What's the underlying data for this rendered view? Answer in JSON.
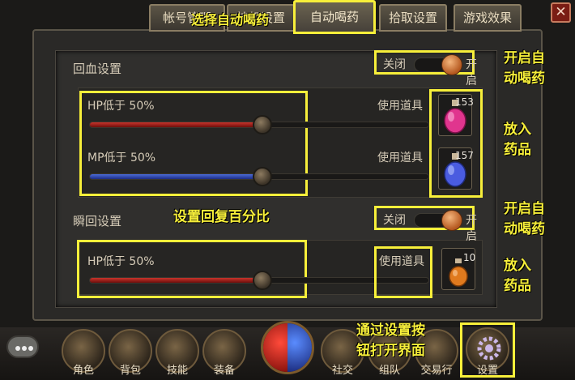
{
  "tabs": [
    {
      "label": "帐号管理"
    },
    {
      "label": "挂机设置"
    },
    {
      "label": "自动喝药"
    },
    {
      "label": "拾取设置"
    },
    {
      "label": "游戏效果"
    }
  ],
  "close_label": "✕",
  "section_hp": {
    "title": "回血设置",
    "toggle": {
      "off_label": "关闭",
      "on_label": "开启",
      "state": "on"
    },
    "rows": [
      {
        "label": "HP低于 50%",
        "value_percent": 50,
        "item_label": "使用道具",
        "count": "153",
        "potion_color": "#e0358e"
      },
      {
        "label": "MP低于 50%",
        "value_percent": 50,
        "item_label": "使用道具",
        "count": "157",
        "potion_color": "#4a5ce0"
      }
    ]
  },
  "section_instant": {
    "title": "瞬回设置",
    "toggle": {
      "off_label": "关闭",
      "on_label": "开启",
      "state": "on"
    },
    "rows": [
      {
        "label": "HP低于 50%",
        "value_percent": 50,
        "item_label": "使用道具",
        "count": "10",
        "potion_color": "#e07a1e"
      }
    ]
  },
  "annotations": {
    "select_tab": "选择自动喝药",
    "enable_1": [
      "开启自",
      "动喝药"
    ],
    "place_1": [
      "放入",
      "药品"
    ],
    "set_percent": "设置回复百分比",
    "enable_2": [
      "开启自",
      "动喝药"
    ],
    "place_2": [
      "放入",
      "药品"
    ],
    "open_settings": [
      "通过设置按",
      "钮打开界面"
    ]
  },
  "bottom_buttons": [
    "角色",
    "背包",
    "技能",
    "装备",
    "社交",
    "组队",
    "交易行",
    "设置"
  ],
  "colors": {
    "highlight": "#f7ef3a",
    "hp": "#c8342c",
    "mp": "#4c6cd6"
  }
}
